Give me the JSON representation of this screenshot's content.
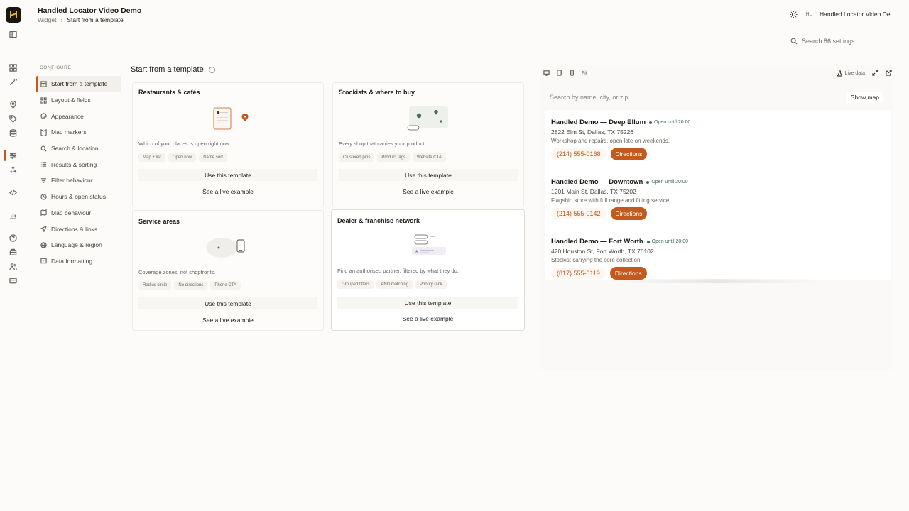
{
  "header": {
    "app_title": "Handled Locator Video Demo",
    "breadcrumb": [
      "Widget",
      "Start from a template"
    ],
    "avatar_initials": "HL",
    "account_name": "Handled Locator Video De..."
  },
  "search_settings": {
    "label": "Search 86 settings"
  },
  "configure": {
    "heading": "CONFIGURE",
    "items": [
      {
        "label": "Start from a template",
        "icon": "template-icon",
        "active": true
      },
      {
        "label": "Layout & fields",
        "icon": "grid-icon"
      },
      {
        "label": "Appearance",
        "icon": "palette-icon"
      },
      {
        "label": "Map markers",
        "icon": "marker-icon"
      },
      {
        "label": "Search & location",
        "icon": "search-icon"
      },
      {
        "label": "Results & sorting",
        "icon": "list-icon"
      },
      {
        "label": "Filter behaviour",
        "icon": "filter-icon"
      },
      {
        "label": "Hours & open status",
        "icon": "clock-icon"
      },
      {
        "label": "Map behaviour",
        "icon": "map-icon"
      },
      {
        "label": "Directions & links",
        "icon": "navigate-icon"
      },
      {
        "label": "Language & region",
        "icon": "globe-icon"
      },
      {
        "label": "Data formatting",
        "icon": "table-icon"
      }
    ]
  },
  "main": {
    "title": "Start from a template",
    "templates": [
      {
        "title": "Restaurants & cafés",
        "desc": "Which of your places is open right now.",
        "chips": [
          "Map + list",
          "Open now",
          "Name sort"
        ],
        "use_label": "Use this template",
        "live_label": "See a live example"
      },
      {
        "title": "Stockists & where to buy",
        "desc": "Every shop that carries your product.",
        "chips": [
          "Clustered pins",
          "Product tags",
          "Website CTA"
        ],
        "use_label": "Use this template",
        "live_label": "See a live example"
      },
      {
        "title": "Service areas",
        "desc": "Coverage zones, not shopfronts.",
        "chips": [
          "Radius circle",
          "No directions",
          "Phone CTA"
        ],
        "use_label": "Use this template",
        "live_label": "See a live example"
      },
      {
        "title": "Dealer & franchise network",
        "desc": "Find an authorised partner, filtered by what they do.",
        "chips": [
          "Grouped filters",
          "AND matching",
          "Priority rank"
        ],
        "use_label": "Use this template",
        "live_label": "See a live example"
      }
    ]
  },
  "preview": {
    "fit_label": "Fit",
    "live_data_label": "Live data",
    "search_placeholder": "Search by name, city, or zip",
    "show_map_label": "Show map",
    "locations": [
      {
        "name": "Handled Demo — Deep Ellum",
        "status": "Open until 20:00",
        "address": "2822 Elm St, Dallas, TX 75226",
        "note": "Workshop and repairs, open late on weekends.",
        "phone": "(214) 555-0168",
        "directions": "Directions"
      },
      {
        "name": "Handled Demo — Downtown",
        "status": "Open until 20:00",
        "address": "1201 Main St, Dallas, TX 75202",
        "note": "Flagship store with full range and fitting service.",
        "phone": "(214) 555-0142",
        "directions": "Directions"
      },
      {
        "name": "Handled Demo — Fort Worth",
        "status": "Open until 20:00",
        "address": "420 Houston St, Fort Worth, TX 76102",
        "note": "Stockist carrying the core collection.",
        "phone": "(817) 555-0119",
        "directions": "Directions"
      }
    ],
    "colors": {
      "accent": "#c25a1d",
      "open_status": "#3d6b55"
    }
  }
}
